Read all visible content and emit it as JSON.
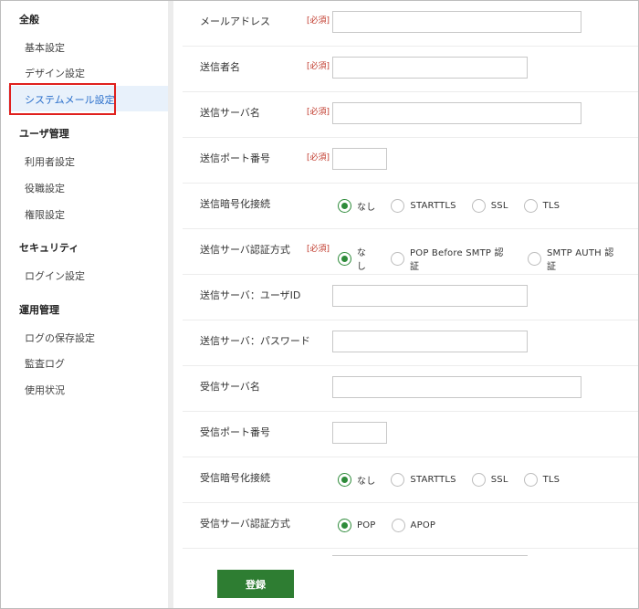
{
  "sidebar": {
    "sections": [
      {
        "title": "全般",
        "items": [
          "基本設定",
          "デザイン設定",
          "システムメール設定"
        ]
      },
      {
        "title": "ユーザ管理",
        "items": [
          "利用者設定",
          "役職設定",
          "権限設定"
        ]
      },
      {
        "title": "セキュリティ",
        "items": [
          "ログイン設定"
        ]
      },
      {
        "title": "運用管理",
        "items": [
          "ログの保存設定",
          "監査ログ",
          "使用状況"
        ]
      }
    ],
    "active_item": "システムメール設定"
  },
  "form": {
    "required_label": "[必須]",
    "rows": [
      {
        "label": "メールアドレス",
        "required": true,
        "type": "text",
        "value": ""
      },
      {
        "label": "送信者名",
        "required": true,
        "type": "text",
        "value": ""
      },
      {
        "label": "送信サーバ名",
        "required": true,
        "type": "text",
        "value": ""
      },
      {
        "label": "送信ポート番号",
        "required": true,
        "type": "text",
        "value": ""
      },
      {
        "label": "送信暗号化接続",
        "required": false,
        "type": "radio",
        "options": [
          "なし",
          "STARTTLS",
          "SSL",
          "TLS"
        ],
        "selected": "なし"
      },
      {
        "label": "送信サーバ認証方式",
        "required": true,
        "type": "radio",
        "options": [
          "なし",
          "POP Before SMTP 認証",
          "SMTP AUTH 認証"
        ],
        "selected": "なし"
      },
      {
        "label": "送信サーバ：ユーザID",
        "required": false,
        "type": "text",
        "value": ""
      },
      {
        "label": "送信サーバ：パスワード",
        "required": false,
        "type": "text",
        "value": ""
      },
      {
        "label": "受信サーバ名",
        "required": false,
        "type": "text",
        "value": ""
      },
      {
        "label": "受信ポート番号",
        "required": false,
        "type": "text",
        "value": ""
      },
      {
        "label": "受信暗号化接続",
        "required": false,
        "type": "radio",
        "options": [
          "なし",
          "STARTTLS",
          "SSL",
          "TLS"
        ],
        "selected": "なし"
      },
      {
        "label": "受信サーバ認証方式",
        "required": false,
        "type": "radio",
        "options": [
          "POP",
          "APOP"
        ],
        "selected": "POP"
      }
    ],
    "submit_label": "登録"
  },
  "colors": {
    "accent_green": "#2e7d32",
    "highlight_red": "#e0201d",
    "active_link": "#2a6fcb",
    "required_red": "#c0392b"
  }
}
